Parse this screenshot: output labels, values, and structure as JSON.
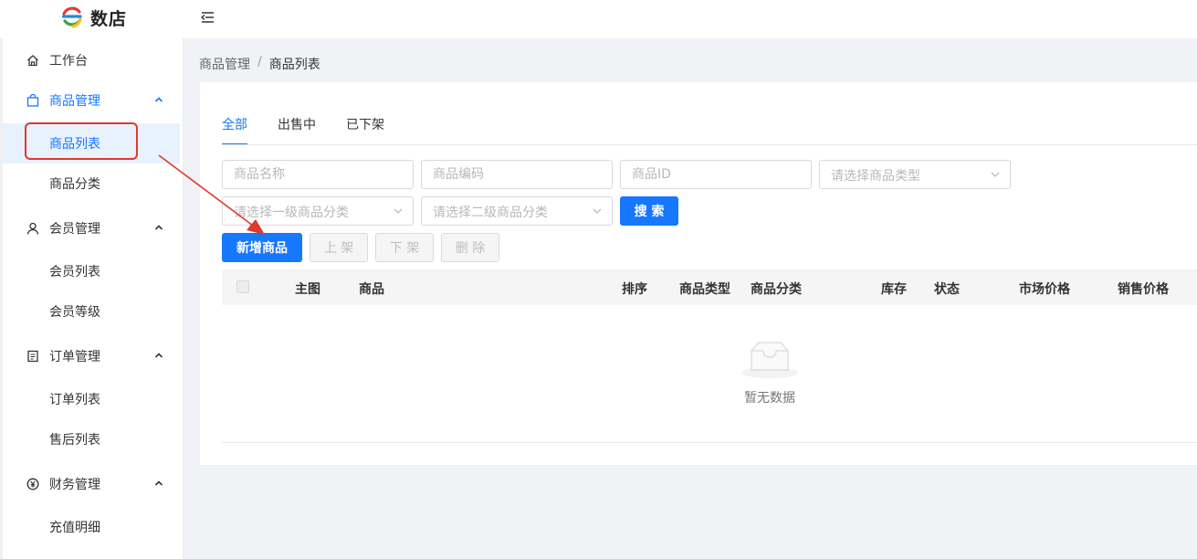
{
  "app": {
    "name": "数店"
  },
  "sidebar": {
    "workbench": "工作台",
    "groups": [
      {
        "label": "商品管理",
        "items": [
          "商品列表",
          "商品分类"
        ]
      },
      {
        "label": "会员管理",
        "items": [
          "会员列表",
          "会员等级"
        ]
      },
      {
        "label": "订单管理",
        "items": [
          "订单列表",
          "售后列表"
        ]
      },
      {
        "label": "财务管理",
        "items": [
          "充值明细"
        ]
      }
    ]
  },
  "breadcrumb": {
    "parent": "商品管理",
    "separator": "/",
    "current": "商品列表"
  },
  "tabs": [
    "全部",
    "出售中",
    "已下架"
  ],
  "filters": {
    "name_placeholder": "商品名称",
    "code_placeholder": "商品编码",
    "id_placeholder": "商品ID",
    "type_placeholder": "请选择商品类型",
    "cat1_placeholder": "请选择一级商品分类",
    "cat2_placeholder": "请选择二级商品分类",
    "search_label": "搜 索"
  },
  "actions": {
    "add": "新增商品",
    "on_shelf": "上 架",
    "off_shelf": "下 架",
    "delete": "删 除"
  },
  "table": {
    "columns": [
      "主图",
      "商品",
      "排序",
      "商品类型",
      "商品分类",
      "库存",
      "状态",
      "市场价格",
      "销售价格"
    ],
    "empty_text": "暂无数据"
  },
  "colors": {
    "primary": "#1677ff",
    "annotation": "#e0382c"
  }
}
